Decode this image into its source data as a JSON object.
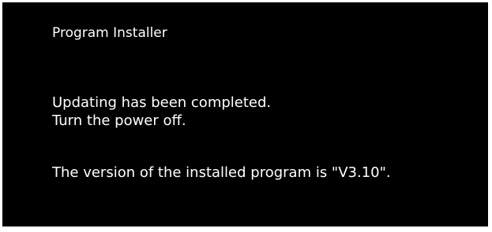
{
  "window": {
    "title": "Program Installer"
  },
  "message": {
    "completed": "Updating has been completed.",
    "instruction": "Turn the power off.",
    "version_text": "The version of the installed program is \"V3.10\"."
  },
  "colors": {
    "background": "#000000",
    "text": "#ffffff",
    "frame": "#ffffff"
  }
}
